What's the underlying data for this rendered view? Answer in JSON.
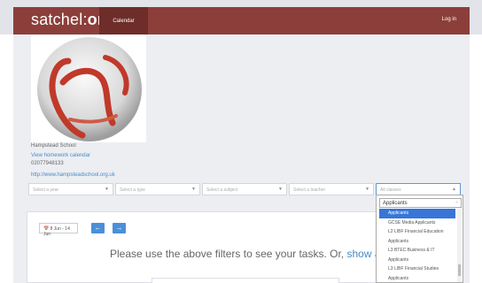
{
  "brand": {
    "name": "satchel",
    "suffix": "one"
  },
  "nav": {
    "calendar_tab": "Calendar",
    "login": "Log in"
  },
  "school": {
    "name": "Hampstead School",
    "calendar_link": "View homework calendar",
    "phone": "02077948133",
    "url": "http://www.hampsteadschool.org.uk"
  },
  "filters": {
    "year": "Select a year",
    "type": "Select a type",
    "subject": "Select a subject",
    "teacher": "Select a teacher",
    "classes": "All classes"
  },
  "calendar": {
    "date_range": "8 Jun - 14 Jun",
    "message": "Please use the above filters to see your tasks. Or,",
    "message_link": "show a"
  },
  "dropdown": {
    "search_value": "Applicants",
    "items": [
      "Applicants",
      "GCSE Media Applicants",
      "L2 LIBF Financial Education",
      "Applicants",
      "L3 BTEC Business & IT",
      "Applicants",
      "L3 LIBF Financial Studies",
      "Applicants"
    ],
    "selected_index": 0
  },
  "colors": {
    "brand_red": "#8c3f3a",
    "accent_blue": "#4a90d9",
    "selected_blue": "#3875d7"
  }
}
